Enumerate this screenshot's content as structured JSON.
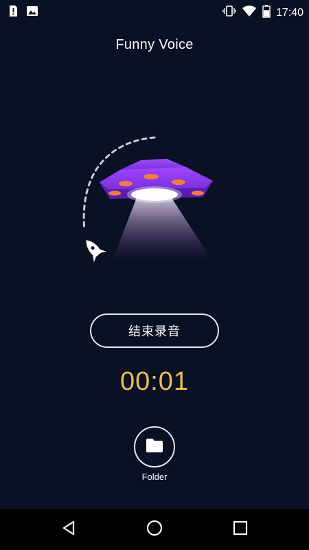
{
  "status_bar": {
    "time": "17:40",
    "left_icons": [
      "sim-alert-icon",
      "image-notification-icon"
    ],
    "right_icons": [
      "vibrate-icon",
      "wifi-icon",
      "battery-icon"
    ]
  },
  "header": {
    "title": "Funny Voice"
  },
  "recording": {
    "stop_label": "结束录音",
    "elapsed": "00:01"
  },
  "folder": {
    "label": "Folder",
    "icon": "folder-icon"
  },
  "nav_bar": {
    "buttons": [
      "back-icon",
      "home-icon",
      "recents-icon"
    ]
  },
  "colors": {
    "background": "#0b1124",
    "timer": "#f0bd52",
    "ufo_body": "#7b2fd6",
    "ufo_lights": "#f07a4a"
  }
}
